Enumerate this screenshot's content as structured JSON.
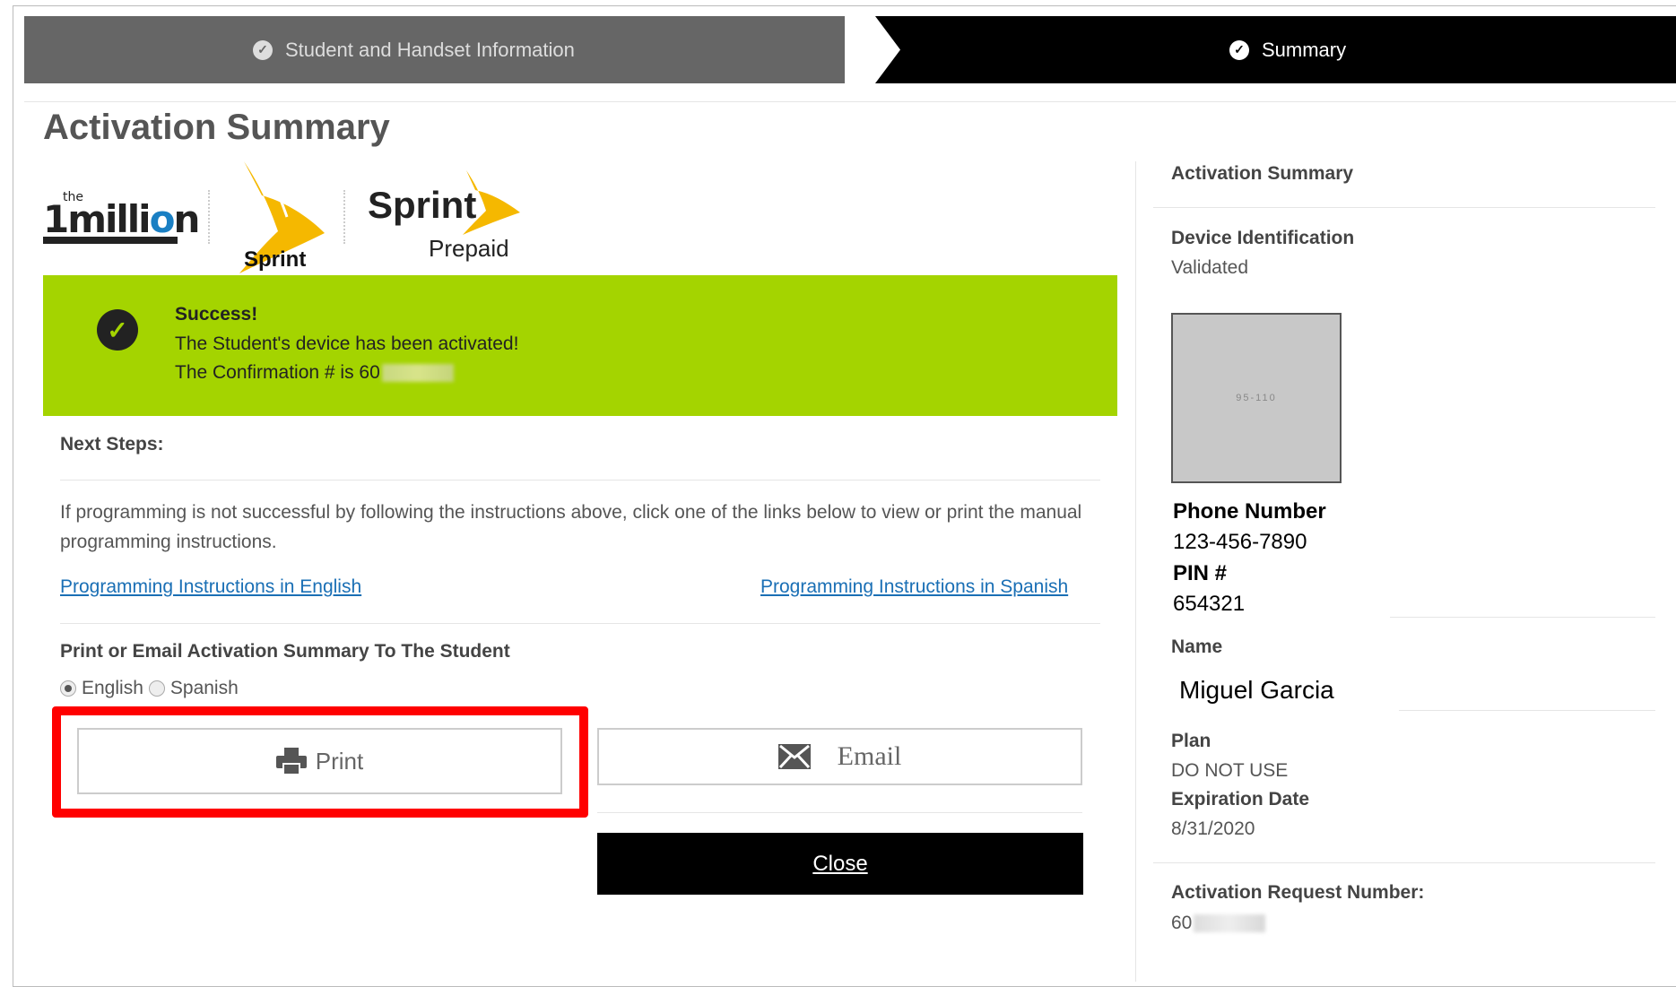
{
  "wizard": {
    "step1_label": "Student and Handset Information",
    "step2_label": "Summary"
  },
  "page_title": "Activation Summary",
  "logos": {
    "million_the": "the",
    "million_word_a": "1milli",
    "million_word_o": "o",
    "million_word_b": "n",
    "sprint_caption": "Sprint",
    "sprint_prepaid_word": "Sprint",
    "sprint_prepaid_sub": "Prepaid"
  },
  "success": {
    "title": "Success!",
    "message": "The Student's device has been activated!",
    "confirmation_prefix": "The Confirmation # is 60"
  },
  "next_steps": {
    "heading": "Next Steps:",
    "instructions": "If programming is not successful by following the instructions above, click one of the links below to view or print the manual programming instructions.",
    "link_english": "Programming Instructions in English",
    "link_spanish": "Programming Instructions in Spanish"
  },
  "print_email": {
    "heading": "Print or Email Activation Summary To The Student",
    "language_options": [
      "English",
      "Spanish"
    ],
    "selected_language": "English",
    "print_label": "Print",
    "email_label": "Email",
    "close_label": "Close"
  },
  "summary_panel": {
    "heading": "Activation Summary",
    "device_id_label": "Device Identification",
    "device_id_value": "Validated",
    "barcode_text": "95-110",
    "phone_label": "Phone Number",
    "phone_value": "123-456-7890",
    "pin_label": "PIN #",
    "pin_value": "654321",
    "name_label": "Name",
    "name_value": "Miguel Garcia",
    "plan_label": "Plan",
    "plan_value": "DO NOT USE",
    "expiration_label": "Expiration Date",
    "expiration_value": "8/31/2020",
    "request_label": "Activation Request Number:",
    "request_prefix": "60"
  },
  "colors": {
    "success_bg": "#a4d400",
    "highlight": "#ff0000",
    "link": "#1a6fb5",
    "active_step": "#000000",
    "inactive_step": "#666666"
  }
}
